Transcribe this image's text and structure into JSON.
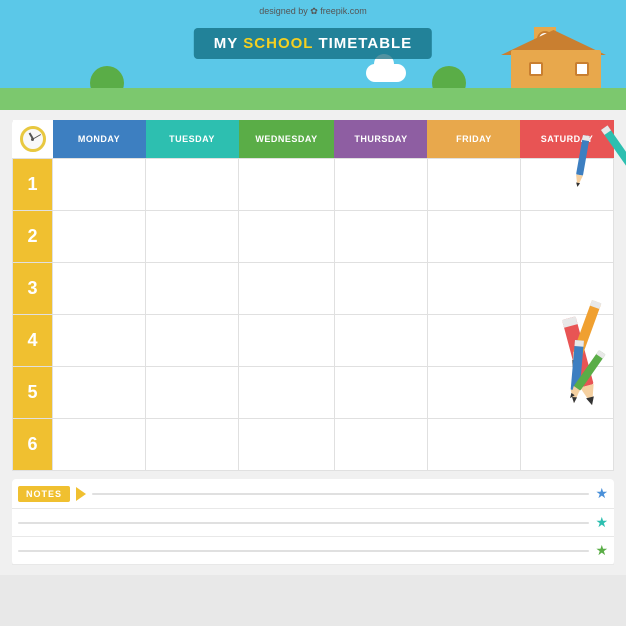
{
  "banner": {
    "title_my": "MY",
    "title_school": "SCHOOL",
    "title_timetable": "TIMETABLE",
    "credit": "designed by ✿ freepik.com"
  },
  "timetable": {
    "days": [
      "MONDAY",
      "TUESDAY",
      "WEDNESDAY",
      "THURSDAY",
      "FRIDAY",
      "SATURDAY"
    ],
    "rows": [
      "1",
      "2",
      "3",
      "4",
      "5",
      "6"
    ]
  },
  "notes": {
    "label": "NOTES",
    "stars": [
      "★",
      "★",
      "★"
    ]
  }
}
